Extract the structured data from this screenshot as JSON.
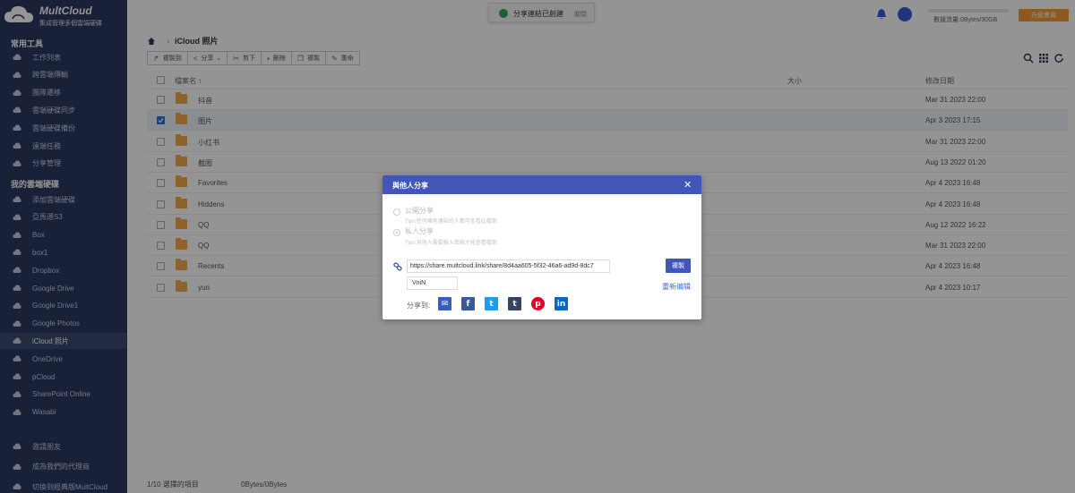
{
  "brand": {
    "title": "MultCloud",
    "subtitle": "集成管理多個雲端硬碟"
  },
  "sidebar": {
    "section_tools": "常用工具",
    "tools": [
      {
        "label": "工作列表",
        "icon": "clipboard-icon"
      },
      {
        "label": "跨雲端傳輸",
        "icon": "cloud-transfer-icon"
      },
      {
        "label": "團隊遷移",
        "icon": "team-migrate-icon"
      },
      {
        "label": "雲端硬碟同步",
        "icon": "cloud-sync-icon"
      },
      {
        "label": "雲端硬碟備份",
        "icon": "cloud-backup-icon"
      },
      {
        "label": "遠端任務",
        "icon": "remote-upload-icon"
      },
      {
        "label": "分享管理",
        "icon": "share-manage-icon"
      }
    ],
    "section_drives": "我的雲端硬碟",
    "drives": [
      {
        "label": "添加雲端硬碟",
        "icon": "add-cloud-icon"
      },
      {
        "label": "亞馬遜S3",
        "icon": "amazon-s3-icon"
      },
      {
        "label": "Box",
        "icon": "box-icon"
      },
      {
        "label": "box1",
        "icon": "box-icon"
      },
      {
        "label": "Dropbox",
        "icon": "dropbox-icon"
      },
      {
        "label": "Google Drive",
        "icon": "google-drive-icon"
      },
      {
        "label": "Google Drive1",
        "icon": "google-drive-icon"
      },
      {
        "label": "Google Photos",
        "icon": "google-photos-icon"
      },
      {
        "label": "iCloud 照片",
        "icon": "icloud-photos-icon"
      },
      {
        "label": "OneDrive",
        "icon": "onedrive-icon"
      },
      {
        "label": "pCloud",
        "icon": "pcloud-icon"
      },
      {
        "label": "SharePoint Online",
        "icon": "sharepoint-icon"
      },
      {
        "label": "Wasabi",
        "icon": "wasabi-icon"
      }
    ],
    "bottom": [
      {
        "label": "邀請朋友",
        "icon": "invite-icon"
      },
      {
        "label": "成為我們的代理商",
        "icon": "agent-icon"
      },
      {
        "label": "切換到經典版MultCloud",
        "icon": "switch-icon"
      }
    ]
  },
  "toast": {
    "message": "分享連結已創建",
    "close": "關閉"
  },
  "header": {
    "traffic": "數據流量:0Bytes/30GB",
    "upgrade": "升級會員"
  },
  "breadcrumb": {
    "current": "iCloud 照片"
  },
  "toolbar": {
    "copy_to": "複製到",
    "share": "分享",
    "cut": "剪下",
    "delete": "刪除",
    "copy": "複製",
    "rename": "重命"
  },
  "table": {
    "col_name": "檔案名 ↑",
    "col_size": "大小",
    "col_date": "修改日期",
    "rows": [
      {
        "name": "抖音",
        "date": "Mar 31 2023 22:00",
        "selected": false
      },
      {
        "name": "图片",
        "date": "Apr 3 2023 17:15",
        "selected": true
      },
      {
        "name": "小红书",
        "date": "Mar 31 2023 22:00",
        "selected": false
      },
      {
        "name": "截图",
        "date": "Aug 13 2022 01:20",
        "selected": false
      },
      {
        "name": "Favorites",
        "date": "Apr 4 2023 16:48",
        "selected": false
      },
      {
        "name": "Hiddens",
        "date": "Apr 4 2023 16:48",
        "selected": false
      },
      {
        "name": "QQ",
        "date": "Aug 12 2022 16:22",
        "selected": false
      },
      {
        "name": "QQ",
        "date": "Mar 31 2023 22:00",
        "selected": false
      },
      {
        "name": "Recents",
        "date": "Apr 4 2023 16:48",
        "selected": false
      },
      {
        "name": "yuo",
        "date": "Apr 4 2023 10:17",
        "selected": false
      }
    ]
  },
  "footer": {
    "selected": "1/10 選擇的項目",
    "size": "0Bytes/0Bytes"
  },
  "modal": {
    "title": "與他人分享",
    "public_label": "公開分享",
    "public_tip": "Tips:任何擁有連結的人都可查看此檔案",
    "private_label": "私人分享",
    "private_tip": "Tips:其他人需要輸入密碼才能查看檔案",
    "url": "https://share.multcloud.link/share/8d4aa605-5f32-46a6-ad9d-8dc7",
    "copy_button": "複製",
    "code": "VniN",
    "reedit": "重新编辑",
    "share_to": "分享到:"
  },
  "colors": {
    "sidebar": "#2c3a63",
    "accent": "#4156b7",
    "upgrade": "#f29b38"
  }
}
